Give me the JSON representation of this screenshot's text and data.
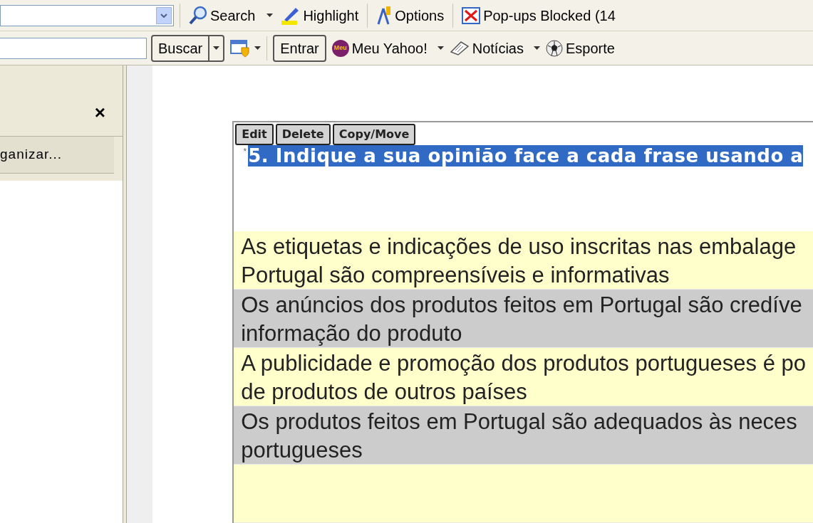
{
  "toolbar_top": {
    "search_button": "Search",
    "highlight_button": "Highlight",
    "options_button": "Options",
    "popups_button": "Pop-ups Blocked (14"
  },
  "toolbar_bottom": {
    "search_button": "Buscar",
    "signin_button": "Entrar",
    "logo_text": "Meu",
    "links": [
      {
        "label": "Meu Yahoo!",
        "kind": "yahoo"
      },
      {
        "label": "Notícias",
        "kind": "news"
      },
      {
        "label": "Esporte",
        "kind": "sports"
      }
    ]
  },
  "side_panel": {
    "close": "×",
    "item": "ganizar..."
  },
  "editor": {
    "buttons": [
      "Edit",
      "Delete",
      "Copy/Move"
    ],
    "required_mark": "*",
    "question": "5. Indique a sua opinião face a cada frase usando a",
    "question_selected": true,
    "rows": [
      {
        "lines": [
          "As etiquetas e indicações de uso inscritas nas embalage",
          "Portugal são compreensíveis e informativas"
        ],
        "color": "#ffffcc"
      },
      {
        "lines": [
          "Os anúncios dos produtos feitos em Portugal são credíve",
          "informação do produto"
        ],
        "color": "#cccccc"
      },
      {
        "lines": [
          "A publicidade e promoção dos produtos portugueses é po",
          "de produtos de outros países"
        ],
        "color": "#ffffcc"
      },
      {
        "lines": [
          "Os produtos feitos em Portugal são adequados às neces",
          "portugueses"
        ],
        "color": "#cccccc"
      },
      {
        "lines": [],
        "color": "#ffffcc"
      }
    ]
  }
}
